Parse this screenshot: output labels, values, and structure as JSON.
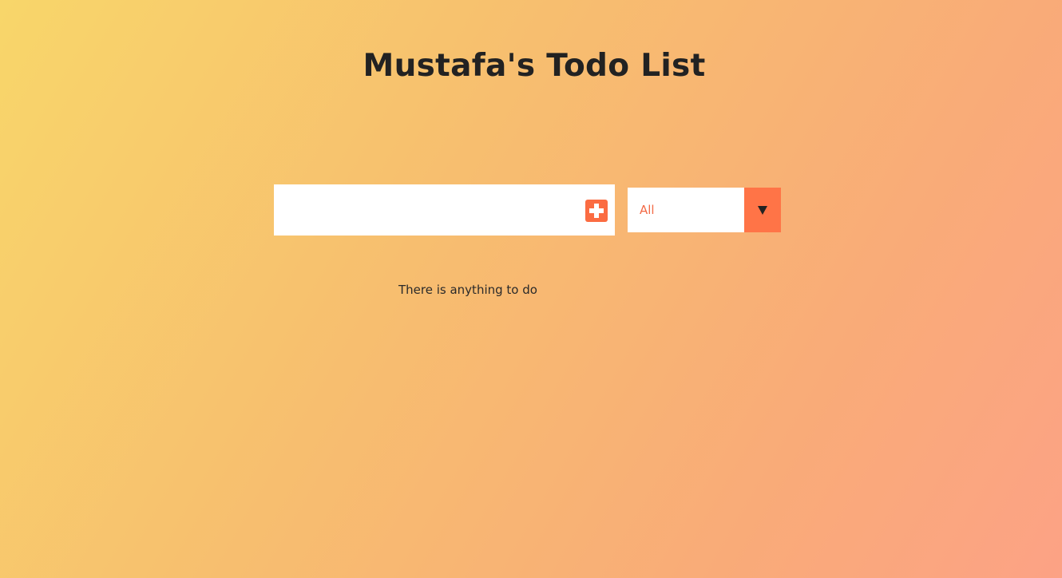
{
  "page": {
    "title": "Mustafa's Todo List"
  },
  "todo_form": {
    "input_value": "",
    "input_placeholder": "",
    "add_button_icon": "plus-icon"
  },
  "filter": {
    "selected": "All",
    "dropdown_icon": "caret-down-icon"
  },
  "todo_list": {
    "items": [],
    "empty_message": "There is anything to do"
  },
  "colors": {
    "accent": "#ff7447",
    "background_start": "#f8d66a",
    "background_end": "#fca285"
  }
}
